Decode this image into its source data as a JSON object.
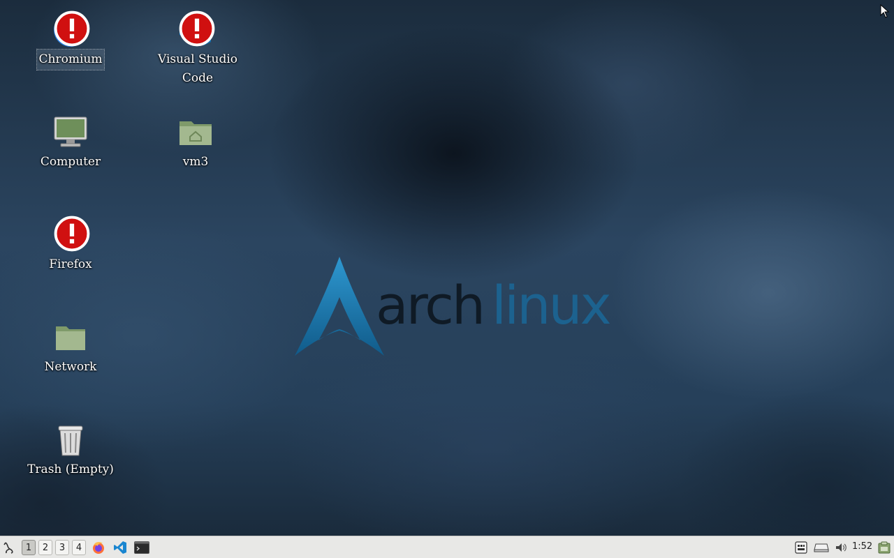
{
  "desktop": {
    "wallpaper_brand": {
      "part1": "arch",
      "part2": "linux"
    },
    "icons": [
      {
        "label": "Chromium"
      },
      {
        "label": "Visual Studio Code"
      },
      {
        "label": "Computer"
      },
      {
        "label": "vm3"
      },
      {
        "label": "Firefox"
      },
      {
        "label": "Network"
      },
      {
        "label": "Trash (Empty)"
      }
    ]
  },
  "taskbar": {
    "workspaces": [
      "1",
      "2",
      "3",
      "4"
    ],
    "active_workspace": "1",
    "launchers": [
      "firefox-icon",
      "vscode-icon",
      "terminal-icon"
    ],
    "tray_icons": [
      "keyboard-layout-icon",
      "drive-icon",
      "volume-icon",
      "clipboard-icon"
    ],
    "clock": "1:52"
  },
  "colors": {
    "taskbar_bg": "#e8e8e6",
    "arch_blue": "#1793d1",
    "label_text": "#ffffff"
  }
}
